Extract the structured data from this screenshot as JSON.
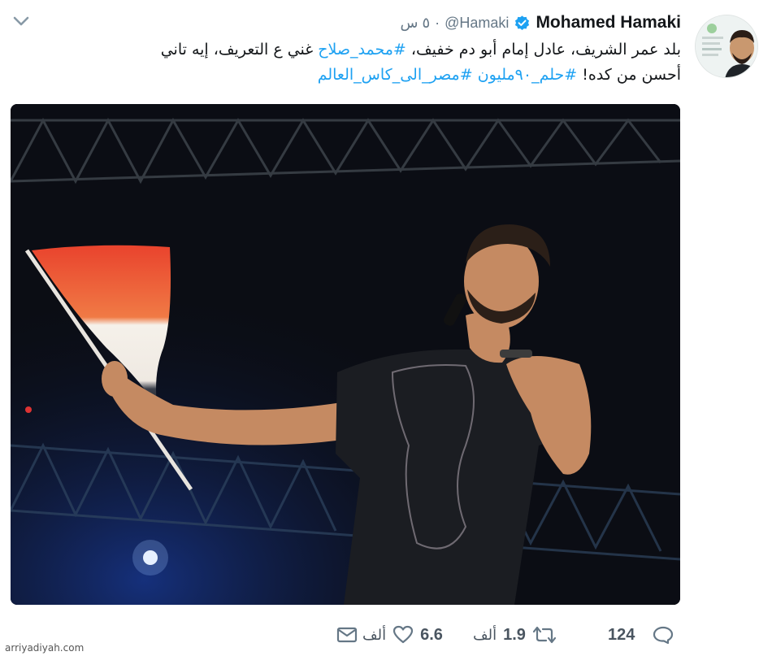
{
  "tweet": {
    "display_name": "Mohamed Hamaki",
    "handle": "@Hamaki",
    "separator": "·",
    "time": "٥ س",
    "text_lines": [
      {
        "before": "بلد عمر الشريف، عادل إمام أبو دم خفيف، ",
        "hashtag": "#محمد_صلاح",
        "after": " غني ع التعريف، إيه تاني"
      },
      {
        "before": "أحسن من كده! ",
        "hashtag": "#حلم_٩٠مليون #مصر_الى_كاس_العالم",
        "after": ""
      }
    ],
    "media_alt": "Singer on stage holding microphone and Egyptian flag"
  },
  "actions": {
    "reply": {
      "icon": "reply-icon",
      "count": "124"
    },
    "retweet": {
      "icon": "retweet-icon",
      "count": "1.9",
      "unit": "ألف"
    },
    "like": {
      "icon": "heart-icon",
      "count": "6.6",
      "unit": "ألف"
    },
    "message": {
      "icon": "envelope-icon"
    }
  },
  "watermark": "arriyadiyah.com",
  "colors": {
    "link": "#1da1f2",
    "muted": "#657786",
    "text": "#14171a",
    "verified": "#1da1f2"
  }
}
